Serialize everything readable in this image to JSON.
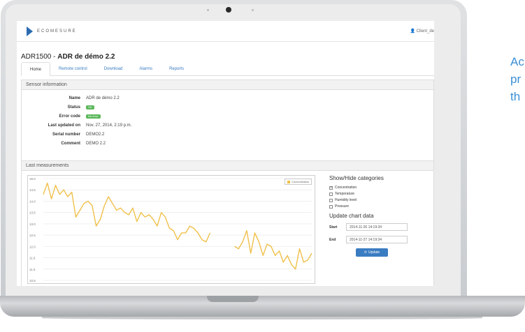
{
  "app": {
    "logo_text": "ECOMESURE",
    "user_label": "Client_de"
  },
  "page": {
    "title_code": "ADR1500",
    "title_sep": " - ",
    "title_name": "ADR de démo 2.2"
  },
  "tabs": [
    "Home",
    "Remote control",
    "Download",
    "Alarms",
    "Reports"
  ],
  "sensor_info": {
    "heading": "Sensor information",
    "rows": [
      {
        "key": "Name",
        "value": "ADR de démo 2.2"
      },
      {
        "key": "Status",
        "value": "OK"
      },
      {
        "key": "Error code",
        "value": "No error"
      },
      {
        "key": "Last updated on",
        "value": "Nov. 27, 2014, 2:19 p.m."
      },
      {
        "key": "Serial number",
        "value": "DEMO2.2"
      },
      {
        "key": "Comment",
        "value": "DEMO 2.2"
      }
    ],
    "badge_color": "#5cb85c"
  },
  "measurements": {
    "heading": "Last measurements",
    "legend": "Concentration"
  },
  "side": {
    "categories_title": "Show/Hide categories",
    "categories": [
      {
        "label": "Concentration",
        "checked": true
      },
      {
        "label": "Temperature",
        "checked": false
      },
      {
        "label": "Humidity level",
        "checked": false
      },
      {
        "label": "Pressure",
        "checked": false
      }
    ],
    "update_title": "Update chart data",
    "start_label": "Start",
    "start_value": "2014-11-26 14:19:34",
    "end_label": "End",
    "end_value": "2014-11-27 14:19:34",
    "update_button": "Update"
  },
  "chart_data": {
    "type": "line",
    "title": "",
    "xlabel": "",
    "ylabel": "",
    "ylim": [
      10.5,
      15.0
    ],
    "yticks": [
      "15.0",
      "14.5",
      "14.0",
      "13.5",
      "13.0",
      "12.5",
      "12.0",
      "11.5",
      "11.0",
      "10.5"
    ],
    "series": [
      {
        "name": "Concentration",
        "color": "#f0c04a",
        "segments": [
          [
            14.3,
            14.8,
            14.1,
            14.7,
            14.3,
            14.5,
            14.2,
            14.4,
            13.3,
            13.6,
            13.9,
            14.0,
            13.8,
            12.9,
            13.2,
            13.8,
            14.2,
            13.9,
            13.6,
            13.7,
            13.5,
            13.4,
            13.7,
            13.1,
            13.5,
            13.3,
            13.4,
            13.2,
            12.9,
            13.5,
            13.3,
            12.8,
            12.7,
            12.3,
            12.6,
            12.6,
            12.9,
            12.8,
            12.6,
            12.3,
            12.2,
            12.6
          ],
          [
            12.0,
            11.9,
            12.2,
            12.7,
            11.7,
            12.6,
            12.2,
            11.6,
            12.1,
            12.0,
            11.6,
            11.8,
            11.3,
            11.6,
            11.2,
            11.0,
            11.9,
            11.3,
            11.4,
            11.7
          ]
        ]
      }
    ],
    "legend": "top-right",
    "grid": true
  }
}
